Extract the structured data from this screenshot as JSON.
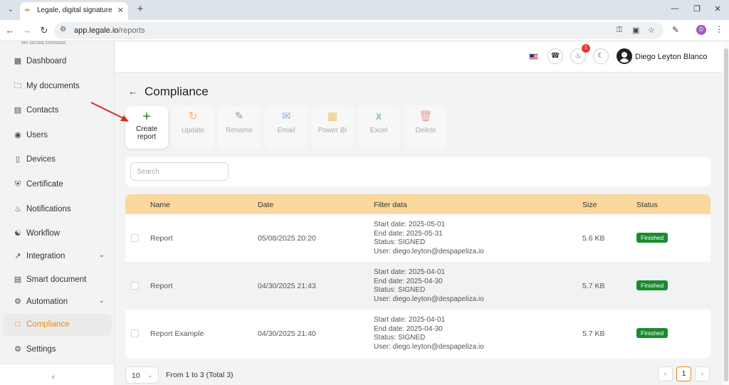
{
  "browser": {
    "tab_title": "Legale, digital signature",
    "url_domain": "app.legale.io",
    "url_path": "/reports",
    "profile_initial": "D"
  },
  "sidebar": {
    "logo_sub": "PAY. SECURE.STRONGER",
    "items": [
      {
        "label": "Dashboard",
        "icon": "dashboard-icon"
      },
      {
        "label": "My documents",
        "icon": "folder-icon"
      },
      {
        "label": "Contacts",
        "icon": "contacts-icon"
      },
      {
        "label": "Users",
        "icon": "user-icon"
      },
      {
        "label": "Devices",
        "icon": "device-icon"
      },
      {
        "label": "Certificate",
        "icon": "shield-icon"
      },
      {
        "label": "Notifications",
        "icon": "bell-icon"
      },
      {
        "label": "Workflow",
        "icon": "workflow-icon"
      },
      {
        "label": "Integration",
        "icon": "integration-icon"
      },
      {
        "label": "Smart document",
        "icon": "smart-document-icon"
      },
      {
        "label": "Automation",
        "icon": "automation-icon"
      },
      {
        "label": "Compliance",
        "icon": "compliance-icon"
      },
      {
        "label": "Settings",
        "icon": "gear-icon"
      }
    ],
    "active": "Compliance"
  },
  "header": {
    "notification_count": "1",
    "user_name": "Diego Leyton Blanco"
  },
  "page": {
    "title": "Compliance",
    "toolbar": {
      "create_line1": "Create",
      "create_line2": "report",
      "update": "Update",
      "rename": "Rename",
      "email": "Email",
      "powerbi": "Power BI",
      "excel": "Excel",
      "delete": "Delete"
    },
    "search_placeholder": "Search"
  },
  "table": {
    "columns": {
      "name": "Name",
      "date": "Date",
      "filter": "Filter data",
      "size": "Size",
      "status": "Status"
    },
    "rows": [
      {
        "name": "Report",
        "date": "05/08/2025 20:20",
        "start": "Start date: 2025-05-01",
        "end": "End date: 2025-05-31",
        "status_filter": "Status: SIGNED",
        "user": "User: diego.leyton@despapeliza.io",
        "size": "5.6 KB",
        "status": "Finished"
      },
      {
        "name": "Report",
        "date": "04/30/2025 21:43",
        "start": "Start date: 2025-04-01",
        "end": "End date: 2025-04-30",
        "status_filter": "Status: SIGNED",
        "user": "User: diego.leyton@despapeliza.io",
        "size": "5.7 KB",
        "status": "Finished"
      },
      {
        "name": "Report Example",
        "date": "04/30/2025 21:40",
        "start": "Start date: 2025-04-01",
        "end": "End date: 2025-04-30",
        "status_filter": "Status: SIGNED",
        "user": "User: diego.leyton@despapeliza.io",
        "size": "5.7 KB",
        "status": "Finished"
      }
    ]
  },
  "pagination": {
    "page_size": "10",
    "range_text": "From 1 to 3 (Total 3)",
    "current_page": "1"
  },
  "colors": {
    "accent": "#e48b17",
    "header_row": "#fbd89c",
    "status_finished": "#1b8a2f"
  }
}
